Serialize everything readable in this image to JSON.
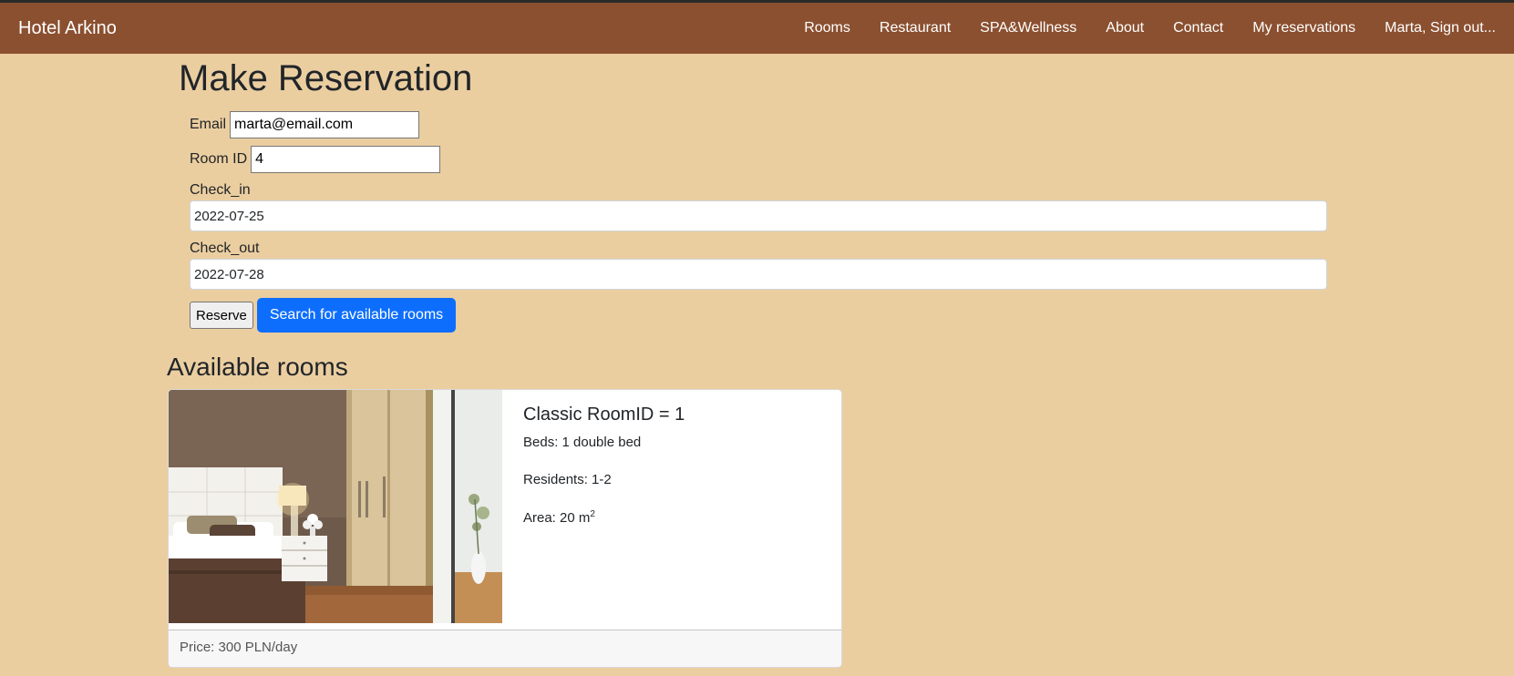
{
  "navbar": {
    "brand": "Hotel Arkino",
    "links": [
      "Rooms",
      "Restaurant",
      "SPA&Wellness",
      "About",
      "Contact",
      "My reservations",
      "Marta, Sign out..."
    ]
  },
  "page": {
    "title": "Make Reservation"
  },
  "form": {
    "email_label": "Email",
    "email_value": "marta@email.com",
    "room_label": "Room ID",
    "room_value": "4",
    "checkin_label": "Check_in",
    "checkin_value": "2022-07-25",
    "checkout_label": "Check_out",
    "checkout_value": "2022-07-28",
    "reserve_label": "Reserve",
    "search_label": "Search for available rooms"
  },
  "available": {
    "title": "Available rooms",
    "rooms": [
      {
        "title": "Classic RoomID = 1",
        "beds": "Beds: 1 double bed",
        "residents": "Residents: 1-2",
        "area_prefix": "Area: 20 m",
        "area_sup": "2",
        "price": "Price: 300 PLN/day"
      }
    ]
  },
  "colors": {
    "background": "#ebcea0",
    "navbar": "#8b5030",
    "primary_button": "#0d6efd"
  }
}
